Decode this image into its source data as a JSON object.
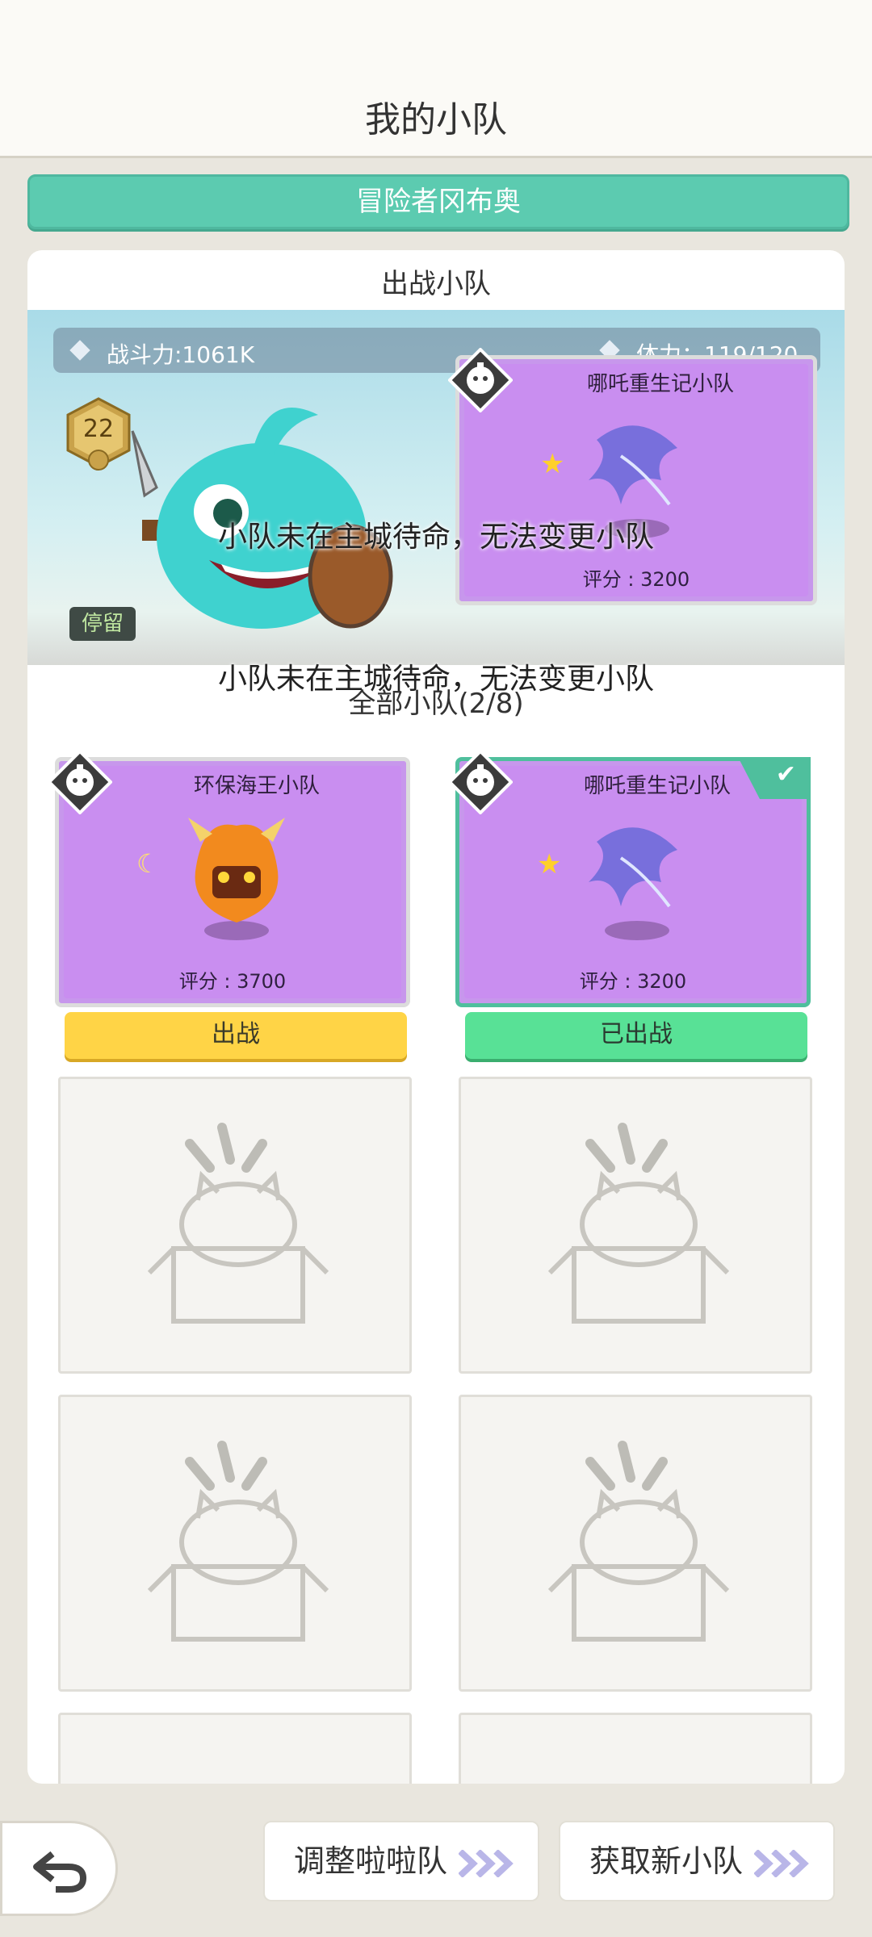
{
  "header": {
    "title": "我的小队"
  },
  "player": {
    "name": "冒险者冈布奥"
  },
  "active_section": {
    "title": "出战小队",
    "combat_power": "战斗力:1061K",
    "stamina": "体力：119/120",
    "level": "22",
    "status": "停留",
    "warning_overlay": "小队未在主城待命，无法变更小队",
    "card": {
      "name": "哪吒重生记小队",
      "score": "评分 : 3200"
    }
  },
  "all_section": {
    "warning_overlay": "小队未在主城待命，无法变更小队",
    "title": "全部小队(2/8)",
    "teams": [
      {
        "name": "环保海王小队",
        "score": "评分 : 3700",
        "button": "出战",
        "selected": false
      },
      {
        "name": "哪吒重生记小队",
        "score": "评分 : 3200",
        "button": "已出战",
        "selected": true
      }
    ]
  },
  "footer": {
    "adjust_button": "调整啦啦队",
    "new_team_button": "获取新小队"
  },
  "colors": {
    "accent": "#5ccbb0",
    "card_purple": "#c98ef0",
    "deploy_yellow": "#ffd446",
    "deployed_green": "#58e196"
  },
  "icons": [
    "diamond-icon",
    "robot-badge-icon",
    "check-icon",
    "empty-box-cat-icon",
    "back-arrow-icon",
    "chevrons-right-icon",
    "star-icon",
    "moon-icon"
  ]
}
